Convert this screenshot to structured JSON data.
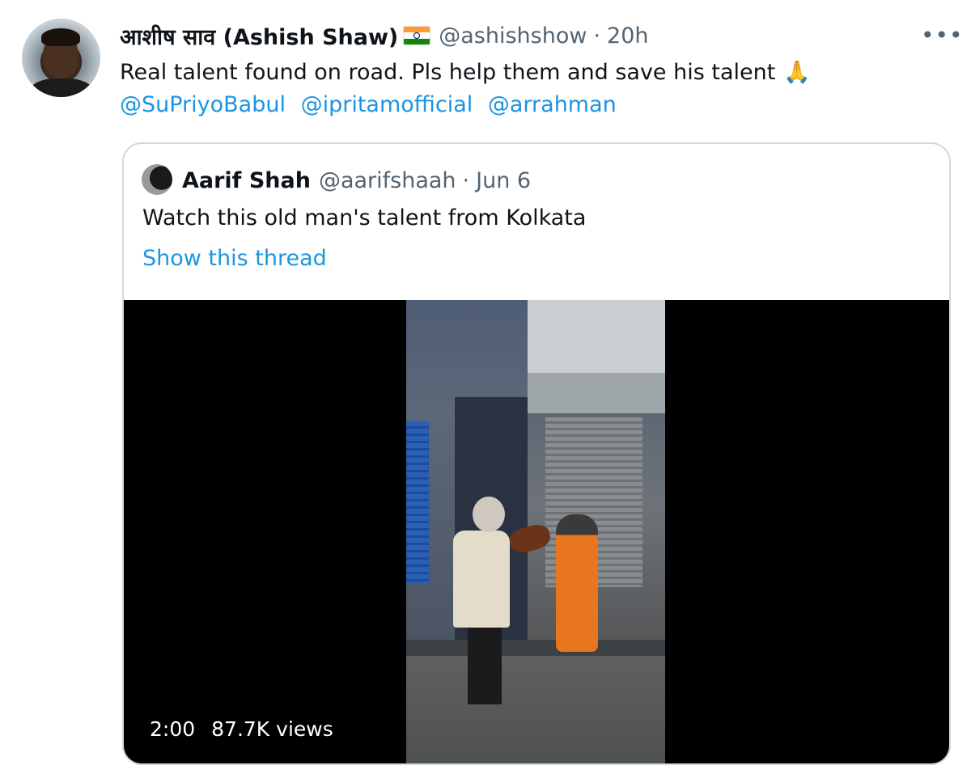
{
  "tweet": {
    "display_name": "आशीष साव (Ashish Shaw)",
    "flag_icon": "india-flag-emoji",
    "handle": "@ashishshow",
    "separator": "·",
    "time": "20h",
    "more_label": "•••",
    "text": "Real talent found on road. Pls help them and save his talent",
    "emoji_icon": "folded-hands-emoji",
    "emoji": "🙏",
    "mentions": [
      "@SuPriyoBabul",
      "@ipritamofficial",
      "@arrahman"
    ]
  },
  "quote": {
    "display_name": "Aarif Shah",
    "handle": "@aarifshaah",
    "separator": "·",
    "date": "Jun 6",
    "text": "Watch this old man's talent from Kolkata",
    "show_thread_label": "Show this thread",
    "video": {
      "duration": "2:00",
      "views": "87.7K views"
    }
  },
  "colors": {
    "link": "#1b95e0",
    "secondary_text": "#536471",
    "border": "#cfd9de"
  }
}
